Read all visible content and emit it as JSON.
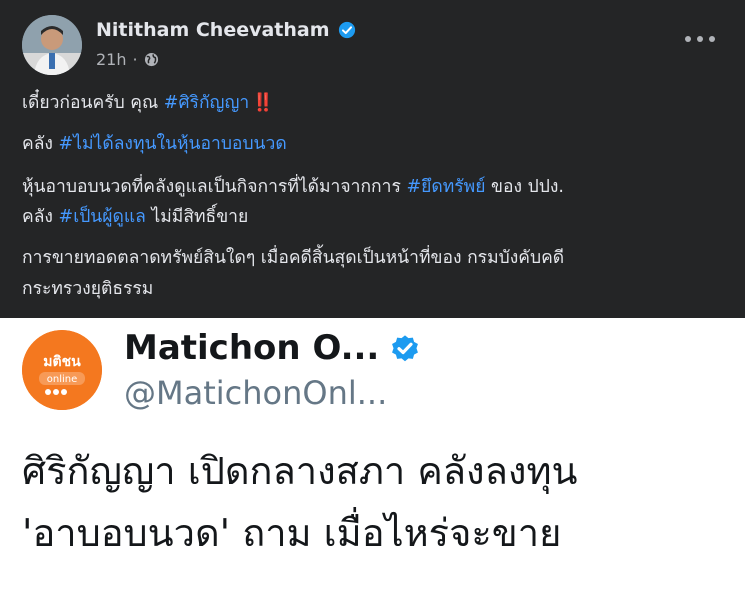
{
  "post": {
    "author": "Nititham Cheevatham",
    "time": "21h",
    "separator": "·",
    "lines": [
      {
        "parts": [
          {
            "text": "เดี๋ยวก่อนครับ คุณ ",
            "tag": false
          },
          {
            "text": "#ศิริกัญญา",
            "tag": true
          },
          {
            "text": " ‼️",
            "tag": false
          }
        ]
      },
      {
        "parts": [
          {
            "text": "คลัง ",
            "tag": false
          },
          {
            "text": "#ไม่ได้ลงทุนในหุ้นอาบอบนวด",
            "tag": true
          }
        ]
      },
      {
        "parts": [
          {
            "text": "หุ้นอาบอบนวดที่คลังดูแลเป็นกิจการที่ได้มาจากการ ",
            "tag": false
          },
          {
            "text": "#ยึดทรัพย์",
            "tag": true
          },
          {
            "text": " ของ ปปง.",
            "tag": false
          }
        ]
      },
      {
        "parts": [
          {
            "text": "คลัง ",
            "tag": false
          },
          {
            "text": "#เป็นผู้ดูแล",
            "tag": true
          },
          {
            "text": " ไม่มีสิทธิ์ขาย",
            "tag": false
          }
        ]
      },
      {
        "parts": [
          {
            "text": "การขายทอดตลาดทรัพย์สินใดๆ เมื่อคดีสิ้นสุดเป็นหน้าที่ของ กรมบังคับคดี",
            "tag": false
          }
        ]
      },
      {
        "parts": [
          {
            "text": "กระทรวงยุติธรรม",
            "tag": false
          }
        ]
      }
    ]
  },
  "tweet": {
    "name": "Matichon O...",
    "handle": "@MatichonOnl...",
    "avatar_text": "มติชน",
    "avatar_sub": "online",
    "body_lines": [
      "ศิริกัญญา เปิดกลางสภา คลังลงทุน",
      "'อาบอบนวด' ถาม เมื่อไหร่จะขาย"
    ]
  },
  "colors": {
    "fb_bg": "#242526",
    "fb_text": "#e4e6eb",
    "hashtag": "#4599ff",
    "verified": "#1d9bf0",
    "matichon_orange": "#f4781f"
  }
}
